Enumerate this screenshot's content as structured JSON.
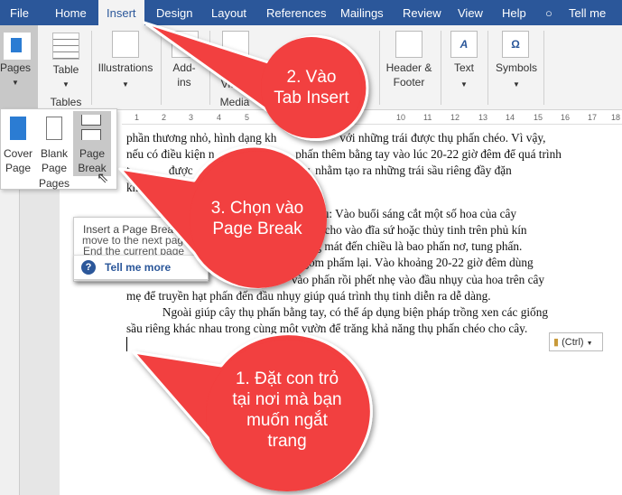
{
  "tabs": [
    "File",
    "Home",
    "Insert",
    "Design",
    "Layout",
    "References",
    "Mailings",
    "Review",
    "View",
    "Help"
  ],
  "tell_me": "Tell me",
  "ribbon": {
    "pages": "Pages",
    "table": "Table",
    "tables_group": "Tables",
    "illustrations": "Illustrations",
    "addins_1": "Add-",
    "addins_2": "ins",
    "video": "Video",
    "media_group": "Media",
    "header_1": "Header &",
    "header_2": "Footer",
    "text": "Text",
    "symbols": "Symbols"
  },
  "pages_panel": {
    "cover_1": "Cover",
    "cover_2": "Page",
    "blank_1": "Blank",
    "blank_2": "Page",
    "break_1": "Page",
    "break_2": "Break",
    "group": "Pages"
  },
  "ruler_labels": [
    "1",
    "2",
    "3",
    "4",
    "5",
    "10",
    "11",
    "12",
    "13",
    "14",
    "15",
    "16",
    "17",
    "18"
  ],
  "tooltip": {
    "title": "Insert a Page Brea",
    "line1": "End the current page",
    "line2": "move to the next page",
    "link": "Tell me more"
  },
  "document": {
    "lines": [
      "phần thương nhỏ, hình dạng kh                     với những trái được thụ phấn chéo. Vì vậy,",
      "nếu có điều kiện n                           phấn thêm bằng tay vào lúc 20-22 giờ đêm để quá trình",
      "t             được                               nhụy, nhằm tạo ra những trái sầu riêng đầy đặn",
      "khoẻ",
      "",
      "                                                       như sau: Vào buổi sáng cắt một số hoa của cây",
      "                                                         được cho vào đĩa sứ hoặc thủy tinh trên phủ kín",
      "                                                         bóng mát đến chiều là bao phấn nơ, tung phấn.",
      "                                                      ấn gom phấm lại. Vào khoảng 20-22 giờ đêm dùng",
      "                                                       vào phấn rồi phết nhẹ vào đầu nhụy của hoa trên cây",
      "mẹ để truyền hạt phấn đến đầu nhụy giúp quá trình thụ tinh diễn ra dễ dàng.",
      "            Ngoài giúp cây thụ phấn bằng tay, có thể áp dụng biện pháp trồng xen các giống",
      "sầu riêng khác nhau trong cùng một vườn để trăng khả năng thụ phấn chéo cho cây."
    ]
  },
  "paste_options": "(Ctrl)",
  "callouts": {
    "step1": [
      "1. Đặt con trỏ",
      "tại nơi mà bạn",
      "muốn ngắt",
      "trang"
    ],
    "step2": [
      "2. Vào",
      "Tab Insert"
    ],
    "step3": [
      "3. Chọn vào",
      "Page Break"
    ]
  },
  "colors": {
    "tab_bar": "#2b579a",
    "callout": "#f23f3f",
    "accent": "#2b579a"
  }
}
